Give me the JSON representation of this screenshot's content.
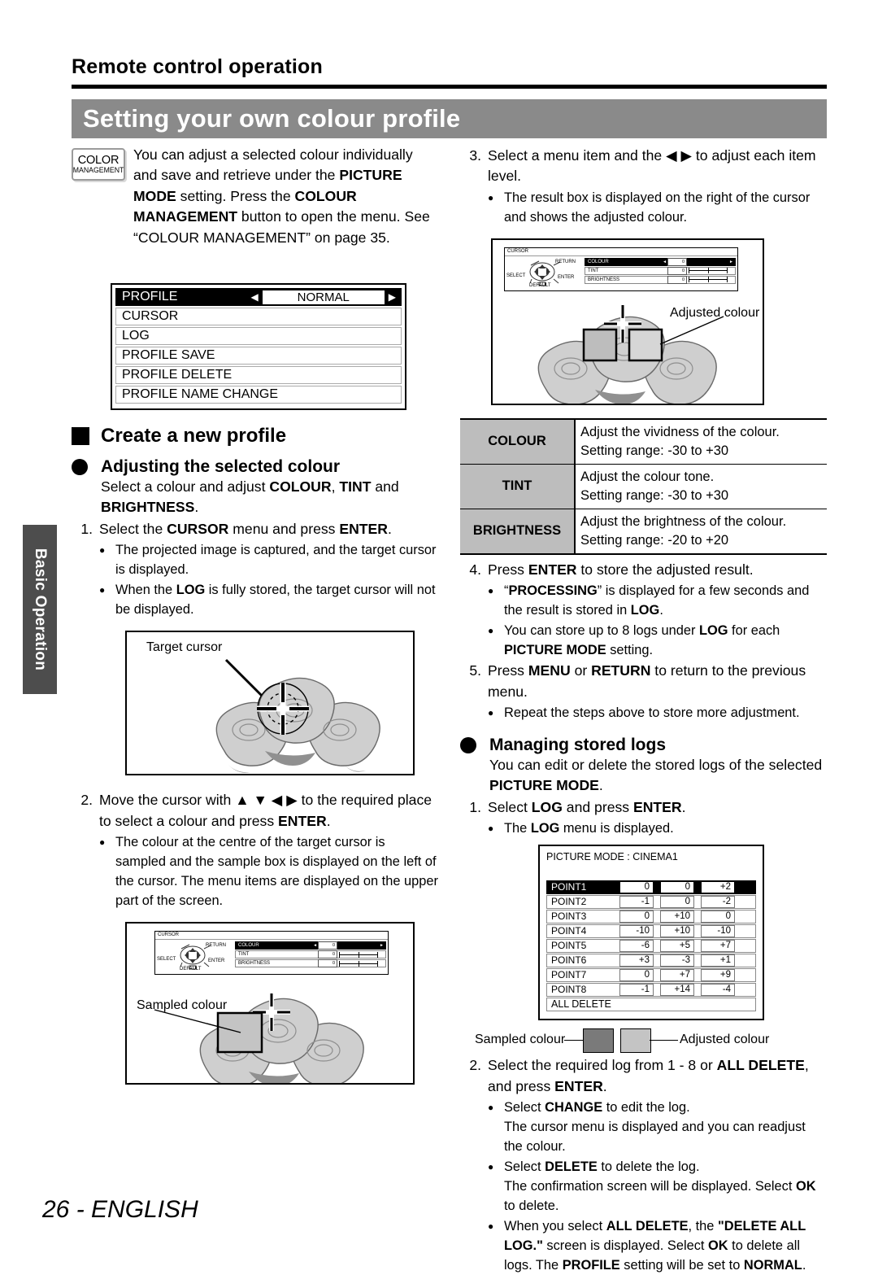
{
  "page": {
    "running_head": "Remote control operation",
    "chapter_title": "Setting your own colour profile",
    "side_tab": "Basic Operation",
    "footer": "26 - ENGLISH"
  },
  "key_icon": {
    "line1": "COLOR",
    "line2": "MANAGEMENT"
  },
  "intro": {
    "part1": "You can adjust a selected colour individually and save and retrieve under the ",
    "b1": "PICTURE MODE",
    "part2": " setting. Press the ",
    "b2": "COLOUR MANAGEMENT",
    "part3": " button to open the menu. See “COLOUR MANAGEMENT” on page 35."
  },
  "profile_menu": {
    "selected_label": "PROFILE",
    "selected_value": "NORMAL",
    "left_arrow": "◀",
    "right_arrow": "▶",
    "items": [
      "CURSOR",
      "LOG",
      "PROFILE SAVE",
      "PROFILE DELETE",
      "PROFILE NAME CHANGE"
    ]
  },
  "section_create": {
    "heading": "Create a new profile"
  },
  "section_adjust": {
    "heading": "Adjusting the selected colour",
    "lead_a": "Select a colour and adjust ",
    "lead_b1": "COLOUR",
    "lead_c": ", ",
    "lead_b2": "TINT",
    "lead_d": " and ",
    "lead_b3": "BRIGHTNESS",
    "lead_e": ".",
    "step1": {
      "num": "1.",
      "t_a": "Select the ",
      "t_b1": "CURSOR",
      "t_c": " menu and press ",
      "t_b2": "ENTER",
      "t_d": ".",
      "bullets": [
        "The projected image is captured, and the target cursor is displayed.",
        "When the LOG is fully stored, the target cursor will not be displayed."
      ]
    },
    "step2": {
      "num": "2.",
      "t_a": "Move the cursor with ▲ ▼ ◀ ▶ to the required place to select a colour and press ",
      "t_b1": "ENTER",
      "t_d": ".",
      "bullets": [
        "The colour at the centre of the target cursor is sampled and the sample box is displayed on the left of the cursor. The menu items are displayed on the upper part of the screen."
      ]
    }
  },
  "figures": {
    "target_cursor_caption": "Target cursor",
    "sampled_colour_caption": "Sampled colour",
    "adjusted_colour_caption": "Adjusted colour"
  },
  "osd_cursor": {
    "header": "CURSOR",
    "select": "SELECT",
    "return": "RETURN",
    "enter": "ENTER",
    "default": "DEFAULT",
    "rows": [
      {
        "name": "COLOUR",
        "value": "0"
      },
      {
        "name": "TINT",
        "value": "0"
      },
      {
        "name": "BRIGHTNESS",
        "value": "0"
      }
    ]
  },
  "right": {
    "step3": {
      "num": "3.",
      "t_a": "Select a menu item and the ◀ ▶ to adjust each item level.",
      "bullets": [
        "The result box is displayed on the right of the cursor and shows the adjusted colour."
      ]
    },
    "step4": {
      "num": "4.",
      "t_a": "Press ",
      "t_b1": "ENTER",
      "t_c": " to store the adjusted result.",
      "bullets": [
        "“PROCESSING” is displayed for a few seconds and the result is stored in LOG.",
        "You can store up to 8 logs under LOG for each PICTURE MODE setting."
      ]
    },
    "step5": {
      "num": "5.",
      "t_a": "Press ",
      "t_b1": "MENU",
      "t_c": " or ",
      "t_b2": "RETURN",
      "t_d": " to return to the previous menu.",
      "bullets": [
        "Repeat the steps above to store more adjustment."
      ]
    }
  },
  "adjust_table": {
    "rows": [
      {
        "key": "COLOUR",
        "l1": "Adjust the vividness of the colour.",
        "l2": "Setting range: -30 to +30"
      },
      {
        "key": "TINT",
        "l1": "Adjust the colour tone.",
        "l2": "Setting range: -30 to +30"
      },
      {
        "key": "BRIGHTNESS",
        "l1": "Adjust the brightness of the colour.",
        "l2": "Setting range: -20 to +20"
      }
    ]
  },
  "section_logs": {
    "heading": "Managing stored logs",
    "lead_a": "You can edit or delete the stored logs of the selected ",
    "lead_b": "PICTURE MODE",
    "lead_c": ".",
    "step1": {
      "num": "1.",
      "t_a": "Select ",
      "t_b1": "LOG",
      "t_c": " and press ",
      "t_b2": "ENTER",
      "t_d": ".",
      "bullets": [
        "The LOG menu is displayed."
      ]
    },
    "step2": {
      "num": "2.",
      "t_a": "Select the required log from 1 - 8 or ",
      "t_b1": "ALL DELETE",
      "t_c": ", and press ",
      "t_b2": "ENTER",
      "t_d": ".",
      "bullets": [
        "Select CHANGE to edit the log.",
        "Select DELETE to delete the log.",
        "When you select ALL DELETE, the \"DELETE ALL LOG.\" screen is displayed. Select OK to delete all logs. The PROFILE setting will be set to NORMAL."
      ],
      "sub1": "The cursor menu is displayed and you can readjust the colour.",
      "sub2": "The confirmation screen will be displayed. Select OK to delete."
    }
  },
  "log_menu": {
    "title": "PICTURE MODE : CINEMA1",
    "all_delete": "ALL DELETE",
    "rows": [
      {
        "name": "POINT1",
        "c1": "0",
        "c2": "0",
        "c3": "+2",
        "selected": true
      },
      {
        "name": "POINT2",
        "c1": "-1",
        "c2": "0",
        "c3": "-2",
        "selected": false
      },
      {
        "name": "POINT3",
        "c1": "0",
        "c2": "+10",
        "c3": "0",
        "selected": false
      },
      {
        "name": "POINT4",
        "c1": "-10",
        "c2": "+10",
        "c3": "-10",
        "selected": false
      },
      {
        "name": "POINT5",
        "c1": "-6",
        "c2": "+5",
        "c3": "+7",
        "selected": false
      },
      {
        "name": "POINT6",
        "c1": "+3",
        "c2": "-3",
        "c3": "+1",
        "selected": false
      },
      {
        "name": "POINT7",
        "c1": "0",
        "c2": "+7",
        "c3": "+9",
        "selected": false
      },
      {
        "name": "POINT8",
        "c1": "-1",
        "c2": "+14",
        "c3": "-4",
        "selected": false
      }
    ]
  },
  "colors": {
    "title_bar": "#8a8a8a",
    "side_tab": "#4d4d4d",
    "table_key_bg": "#bdbdbd",
    "sampled_swatch": "#7a7a7a",
    "adjusted_swatch": "#c4c4c4"
  }
}
